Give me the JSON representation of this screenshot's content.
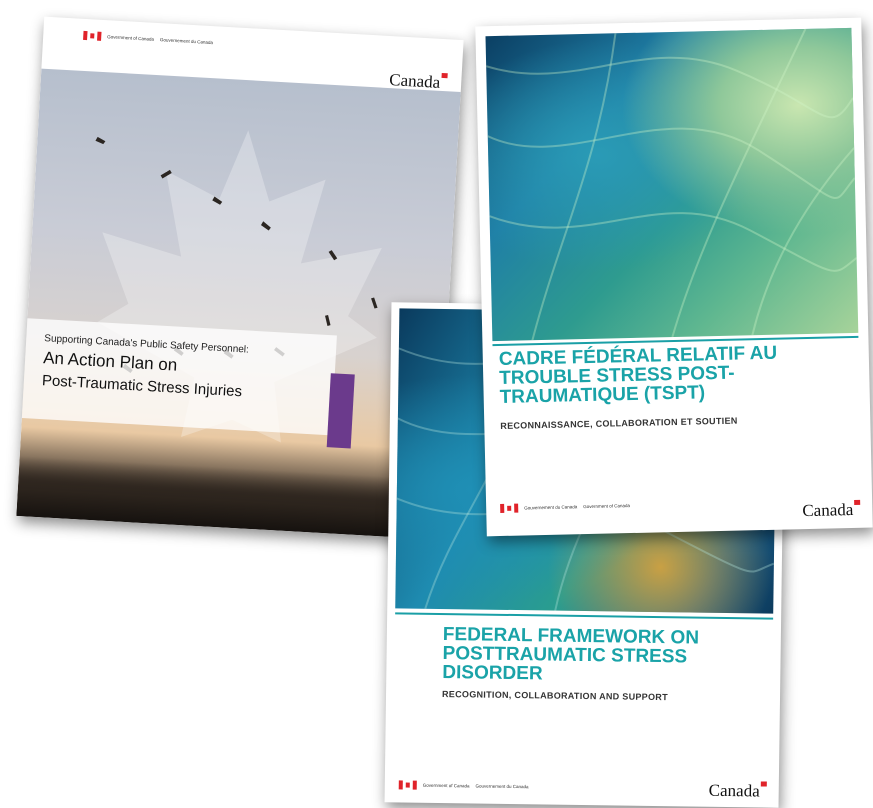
{
  "action_plan": {
    "gov_en": "Government of Canada",
    "gov_fr": "Gouvernement du Canada",
    "wordmark": "Canada",
    "subtitle": "Supporting Canada's Public Safety Personnel:",
    "title_line1": "An Action Plan on",
    "title_line2": "Post-Traumatic Stress Injuries",
    "accent_color": "#6b3a8c"
  },
  "cadre": {
    "title": "CADRE FÉDÉRAL RELATIF AU TROUBLE STRESS POST-TRAUMATIQUE (TSPT)",
    "subtitle": "RECONNAISSANCE, COLLABORATION ET SOUTIEN",
    "gov_fr": "Gouvernement du Canada",
    "gov_en": "Government of Canada",
    "wordmark": "Canada",
    "title_color": "#1aa3a8"
  },
  "federal": {
    "title": "FEDERAL FRAMEWORK ON POSTTRAUMATIC STRESS DISORDER",
    "subtitle": "RECOGNITION, COLLABORATION AND SUPPORT",
    "gov_en": "Government of Canada",
    "gov_fr": "Gouvernement du Canada",
    "wordmark": "Canada",
    "title_color": "#1aa3a8"
  }
}
